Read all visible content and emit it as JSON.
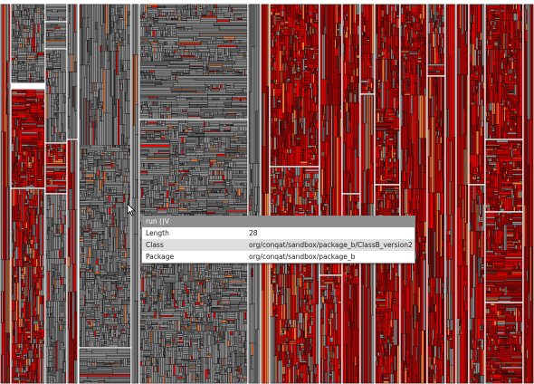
{
  "treemap": {
    "colors": {
      "gray": "#8c8c8c",
      "red": "#ee0000",
      "dark_red": "#b00000",
      "orange": "#f07a3a",
      "cell_border": "#101010",
      "frame": "#ffffff"
    }
  },
  "tooltip": {
    "title": "run ()V",
    "rows": [
      {
        "key": "Length",
        "value": "28"
      },
      {
        "key": "Class",
        "value": "org/conqat/sandbox/package_b/ClassB_version2"
      },
      {
        "key": "Package",
        "value": "org/conqat/sandbox/package_b"
      }
    ]
  },
  "cursor": {
    "icon": "mouse-pointer-icon"
  }
}
